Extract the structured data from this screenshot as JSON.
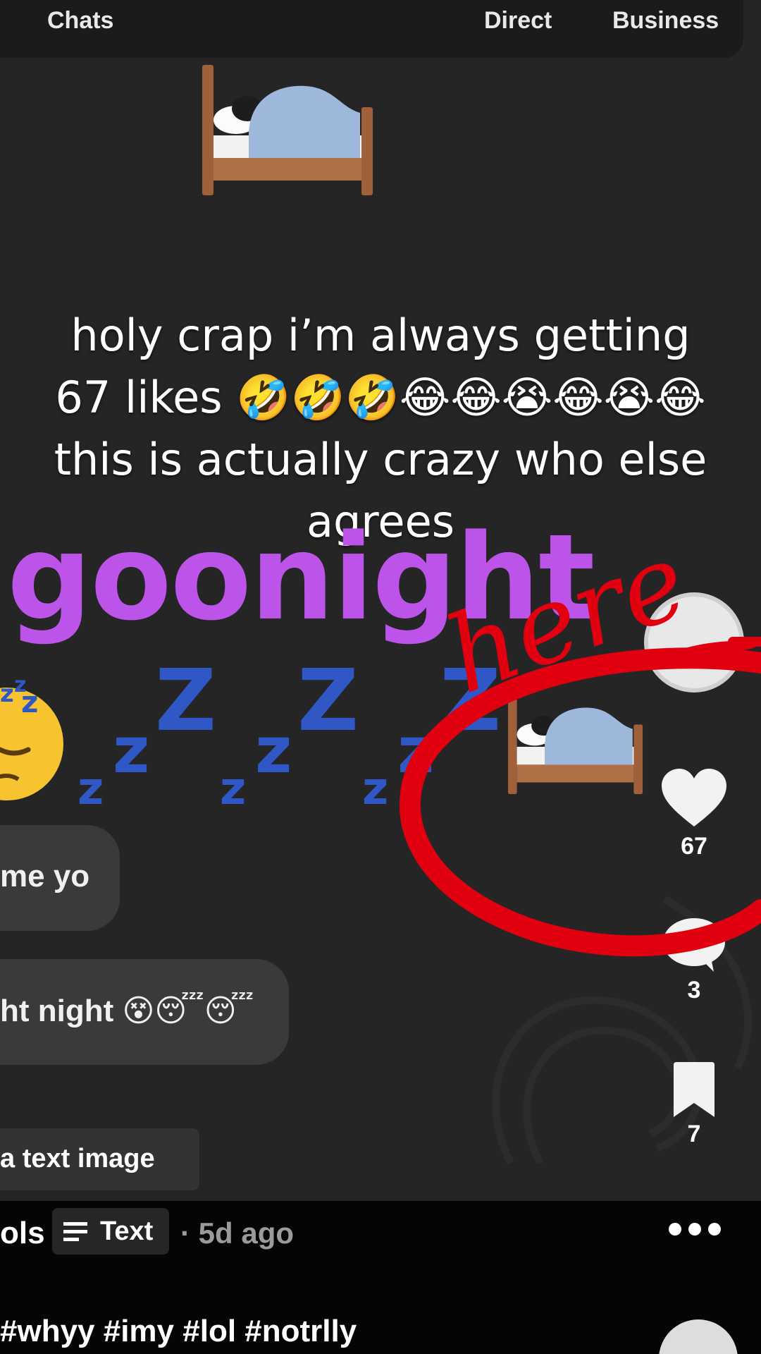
{
  "top_tabs": {
    "chats": "Chats",
    "direct": "Direct",
    "business": "Business"
  },
  "caption": {
    "line1": "holy crap i’m always getting",
    "line2": "67 likes 🤣🤣🤣😂😂😭😂😭😂",
    "line3": "this is actually crazy who else",
    "line4": "agrees"
  },
  "overlay": {
    "goonight": "goonight",
    "annotation": "here"
  },
  "messages": {
    "bubble1": "me yo",
    "bubble2": "ht night 😵😴😴",
    "text_image": "a text image"
  },
  "actions": {
    "likes": "67",
    "comments": "3",
    "saves": "7"
  },
  "post": {
    "author_fragment": "ols",
    "type_chip": "Text",
    "time": "· 5d ago",
    "hashtags": "#whyy #imy #lol #notrlly"
  },
  "colors": {
    "goonight": "#bd54e9",
    "zzz": "#2f57c6",
    "annotation_red": "#e00010"
  }
}
